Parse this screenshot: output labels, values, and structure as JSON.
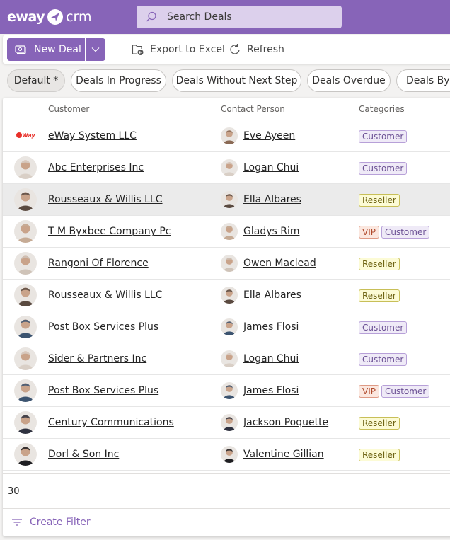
{
  "app": {
    "logo_left": "eway",
    "logo_right": "crm",
    "search_placeholder": "Search Deals"
  },
  "toolbar": {
    "new_deal": "New Deal",
    "export": "Export to Excel",
    "refresh": "Refresh"
  },
  "views": [
    {
      "label": "Default *",
      "active": true
    },
    {
      "label": "Deals In Progress",
      "active": false
    },
    {
      "label": "Deals Without Next Step",
      "active": false
    },
    {
      "label": "Deals Overdue",
      "active": false
    },
    {
      "label": "Deals By C",
      "active": false
    }
  ],
  "grid": {
    "columns": [
      "Customer",
      "Contact Person",
      "Categories"
    ],
    "rows": [
      {
        "customer": "eWay System LLC",
        "customer_avatar": "eway-logo",
        "contact": "Eve Ayeen",
        "contact_avatar": "#8a6a55",
        "categories": [
          "Customer"
        ],
        "selected": false
      },
      {
        "customer": "Abc Enterprises Inc",
        "customer_avatar": "#d9cfc6",
        "contact": "Logan Chui",
        "contact_avatar": "#d9cfc6",
        "categories": [
          "Customer"
        ],
        "selected": false
      },
      {
        "customer": "Rousseaux & Willis LLC",
        "customer_avatar": "#5a4a40",
        "contact": "Ella Albares",
        "contact_avatar": "#5a4a40",
        "categories": [
          "Reseller"
        ],
        "selected": true
      },
      {
        "customer": "T M Byxbee Company Pc",
        "customer_avatar": "#c6ab95",
        "contact": "Gladys Rim",
        "contact_avatar": "#c6ab95",
        "categories": [
          "VIP",
          "Customer"
        ],
        "selected": false
      },
      {
        "customer": "Rangoni Of Florence",
        "customer_avatar": "#cfc3b8",
        "contact": "Owen Maclead",
        "contact_avatar": "#cfc3b8",
        "categories": [
          "Reseller"
        ],
        "selected": false
      },
      {
        "customer": "Rousseaux & Willis LLC",
        "customer_avatar": "#5a4a40",
        "contact": "Ella Albares",
        "contact_avatar": "#5a4a40",
        "categories": [
          "Reseller"
        ],
        "selected": false
      },
      {
        "customer": "Post Box Services Plus",
        "customer_avatar": "#3c5470",
        "contact": "James Flosi",
        "contact_avatar": "#3c5470",
        "categories": [
          "Customer"
        ],
        "selected": false
      },
      {
        "customer": "Sider & Partners Inc",
        "customer_avatar": "#d9cfc6",
        "contact": "Logan Chui",
        "contact_avatar": "#d9cfc6",
        "categories": [
          "Customer"
        ],
        "selected": false
      },
      {
        "customer": "Post Box Services Plus",
        "customer_avatar": "#3c5470",
        "contact": "James Flosi",
        "contact_avatar": "#3c5470",
        "categories": [
          "VIP",
          "Customer"
        ],
        "selected": false
      },
      {
        "customer": "Century Communications",
        "customer_avatar": "#2f3240",
        "contact": "Jackson Poquette",
        "contact_avatar": "#2f3240",
        "categories": [
          "Reseller"
        ],
        "selected": false
      },
      {
        "customer": "Dorl & Son Inc",
        "customer_avatar": "#1e1e22",
        "contact": "Valentine Gillian",
        "contact_avatar": "#1e1e22",
        "categories": [
          "Reseller"
        ],
        "selected": false
      }
    ]
  },
  "footer": {
    "count": "30",
    "create_filter": "Create Filter"
  },
  "colors": {
    "brand": "#8764b8",
    "search_bg": "#dcd0ec"
  }
}
